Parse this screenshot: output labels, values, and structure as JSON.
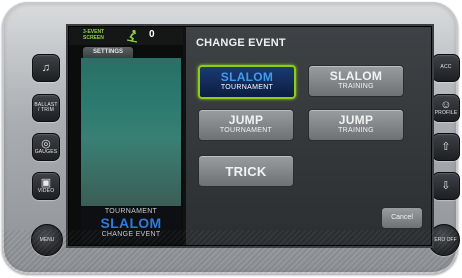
{
  "status_bar": {
    "screen_label_line1": "3-EVENT",
    "screen_label_line2": "SCREEN",
    "skier_count": "0",
    "settings_tab": "SETTINGS"
  },
  "mode": {
    "line1": "TOURNAMENT",
    "line2": "SLALOM",
    "line3": "CHANGE EVENT"
  },
  "dialog": {
    "title": "CHANGE EVENT",
    "options": [
      {
        "line1": "SLALOM",
        "line2": "TOURNAMENT",
        "selected": true
      },
      {
        "line1": "SLALOM",
        "line2": "TRAINING",
        "selected": false
      },
      {
        "line1": "JUMP",
        "line2": "TOURNAMENT",
        "selected": false
      },
      {
        "line1": "JUMP",
        "line2": "TRAINING",
        "selected": false
      },
      {
        "line1": "TRICK",
        "line2": "",
        "selected": false
      }
    ],
    "cancel_label": "Cancel"
  },
  "hardware": {
    "left_buttons": [
      {
        "icon": "music-note-icon",
        "label": ""
      },
      {
        "icon": "ballast-icon",
        "label": "BALLAST / TRIM"
      },
      {
        "icon": "gauges-icon",
        "label": "GAUGES"
      },
      {
        "icon": "video-icon",
        "label": "VIDEO"
      }
    ],
    "menu_label": "MENU",
    "right_buttons": [
      {
        "icon": "acc-icon",
        "label": "ACC"
      },
      {
        "icon": "profile-icon",
        "label": "PROFILE"
      },
      {
        "icon": "arrow-up-icon",
        "label": ""
      },
      {
        "icon": "arrow-down-icon",
        "label": ""
      }
    ],
    "zerooff_label": "ZERO OFF"
  },
  "colors": {
    "selected_border": "#8fcc1a",
    "slalom_blue": "#2b7be0",
    "status_green": "#8ed14a"
  }
}
